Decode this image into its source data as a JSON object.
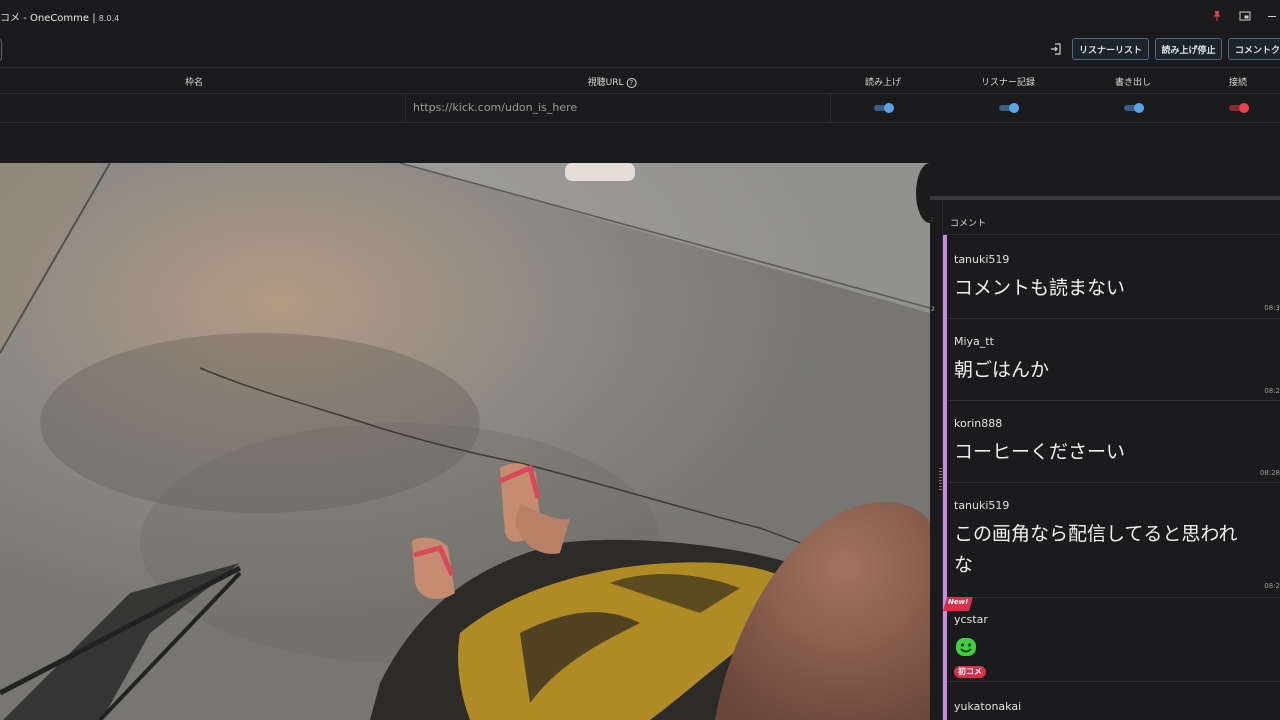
{
  "app": {
    "title": "コメ - OneComme | ",
    "version": "8.0.4"
  },
  "toolbar": {
    "buttons": [
      "リスナーリスト",
      "読み上げ停止",
      "コメントク"
    ]
  },
  "table": {
    "headers": {
      "name": "枠名",
      "url": "視聴URL",
      "read": "読み上げ",
      "listener": "リスナー記録",
      "export": "書き出し",
      "connect": "接続"
    },
    "row": {
      "url": "https://kick.com/udon_is_here",
      "read_on": true,
      "listener_on": true,
      "export_on": true,
      "connect_on": true
    }
  },
  "colors": {
    "toggle_on": "#5aa3e6",
    "connect_on": "#e8424f",
    "accent": "#c88be0",
    "badge": "#d9304a"
  },
  "panel": {
    "column_header": "コメント",
    "gutter_labels": [
      ":",
      "2"
    ],
    "new_label": "New!",
    "comments": [
      {
        "name": "tanuki519",
        "text": "コメントも読まない",
        "time": "08:3"
      },
      {
        "name": "Miya_tt",
        "text": "朝ごはんか",
        "time": "08:2"
      },
      {
        "name": "korin888",
        "text": "コーヒーくださーい",
        "time": "08:28"
      },
      {
        "name": "tanuki519",
        "text_line1": "この画角なら配信してると思われ",
        "text_line2": "な",
        "time": "08:2"
      },
      {
        "name": "ycstar",
        "badge": "初コメ"
      },
      {
        "name": "yukatonakai"
      }
    ]
  },
  "video": {
    "icon": "camera-feed"
  }
}
